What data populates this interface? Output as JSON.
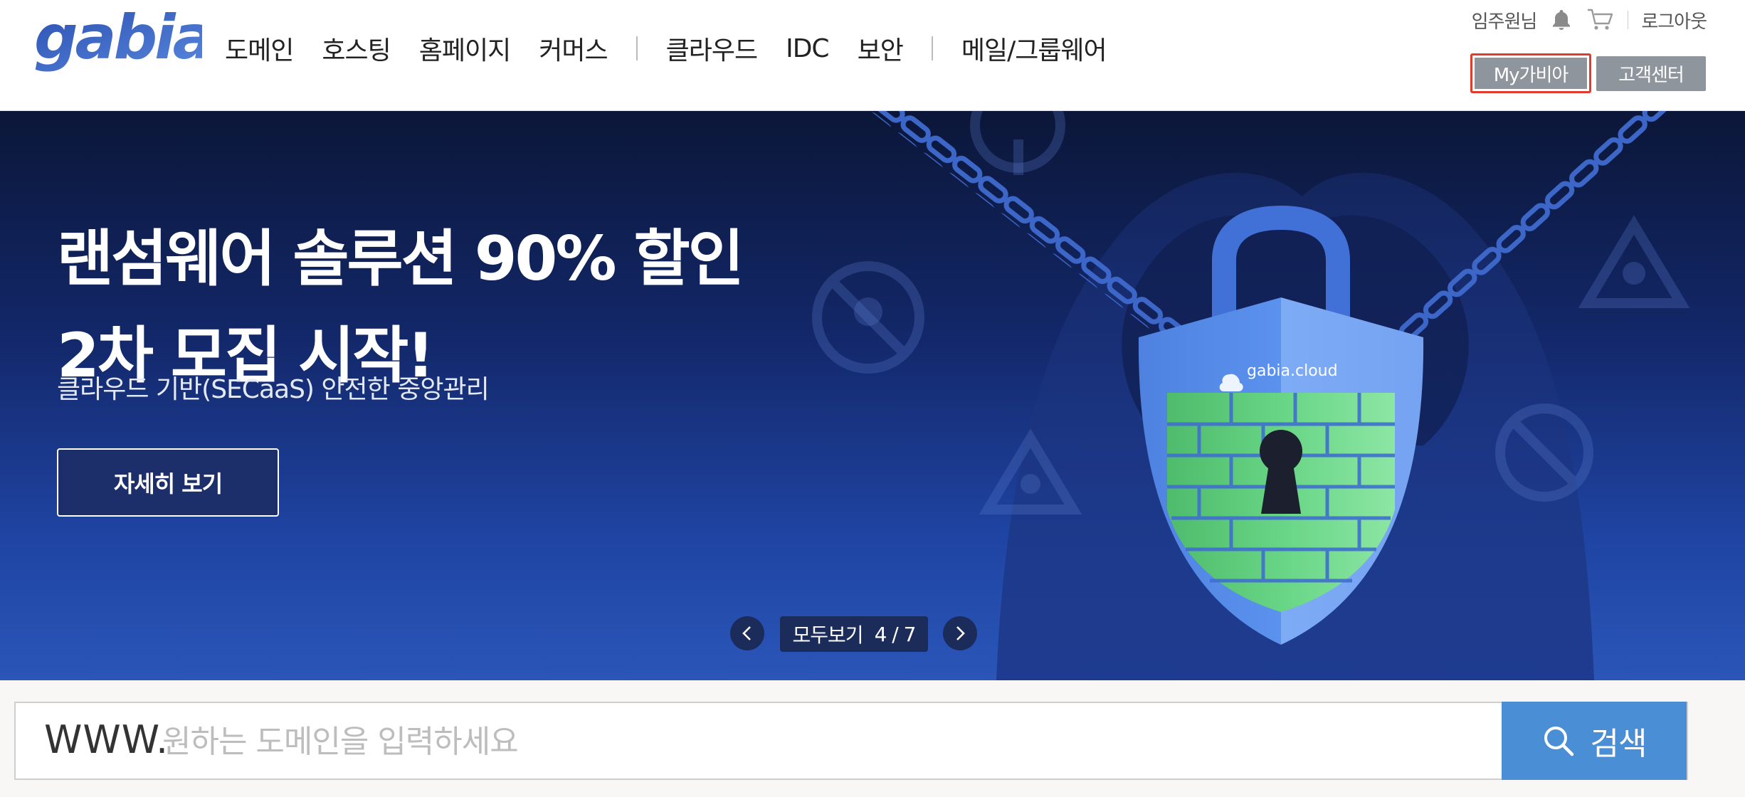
{
  "header": {
    "logo_text": "gabia.",
    "nav": [
      "도메인",
      "호스팅",
      "홈페이지",
      "커머스",
      "클라우드",
      "IDC",
      "보안",
      "메일/그룹웨어"
    ],
    "user_name": "임주원님",
    "logout": "로그아웃",
    "my_gabia": "My가비아",
    "customer_center": "고객센터",
    "icons": [
      "bell-icon",
      "cart-icon"
    ]
  },
  "hero": {
    "title_line1": "랜섬웨어 솔루션 90% 할인",
    "title_line2": "2차 모집 시작!",
    "subtitle": "클라우드 기반(SECaaS) 안전한 중앙관리",
    "detail_button": "자세히 보기",
    "shield_label": "gabia.cloud",
    "pager": {
      "view_all": "모두보기",
      "current": "4",
      "total": "7",
      "separator": "/"
    }
  },
  "search": {
    "prefix": "WWW.",
    "placeholder": "원하는 도메인을 입력하세요",
    "value": "",
    "button": "검색"
  },
  "colors": {
    "accent_blue": "#4a8fd6",
    "highlight_red": "#e03b2c",
    "hero_top": "#0b1638",
    "hero_bottom": "#2a56b8",
    "shield_blue": "#5a8ee6",
    "brick_green": "#6bd88a"
  }
}
